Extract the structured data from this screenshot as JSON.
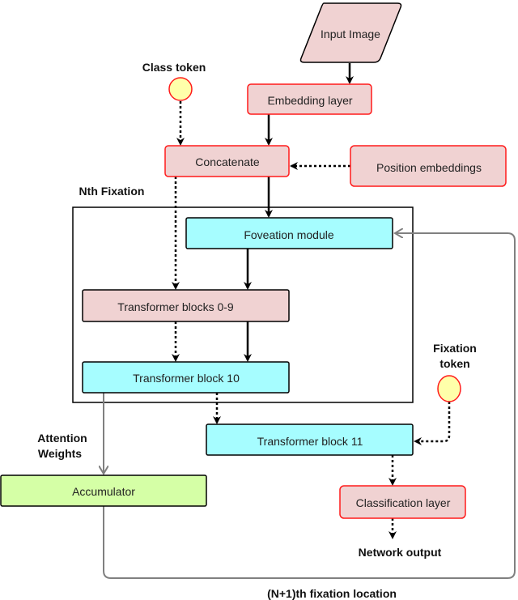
{
  "colors": {
    "pink_fill": "#f0d2d2",
    "red_stroke": "#ff1a1a",
    "cyan_fill": "#a6fdff",
    "green_fill": "#d5ffa6",
    "token_fill": "#ffffaa",
    "gray_line": "#808080"
  },
  "nodes": {
    "input_image": "Input Image",
    "embedding_layer": "Embedding layer",
    "concatenate": "Concatenate",
    "position_embeddings": "Position embeddings",
    "foveation_module": "Foveation module",
    "transformer_blocks_0_9": "Transformer blocks 0-9",
    "transformer_block_10": "Transformer block 10",
    "transformer_block_11": "Transformer block 11",
    "accumulator": "Accumulator",
    "classification_layer": "Classification layer"
  },
  "labels": {
    "class_token": "Class token",
    "nth_fixation": "Nth Fixation",
    "fixation_token_1": "Fixation",
    "fixation_token_2": "token",
    "attention_weights_1": "Attention",
    "attention_weights_2": "Weights",
    "network_output": "Network output",
    "next_fixation_location": "(N+1)th fixation location"
  }
}
